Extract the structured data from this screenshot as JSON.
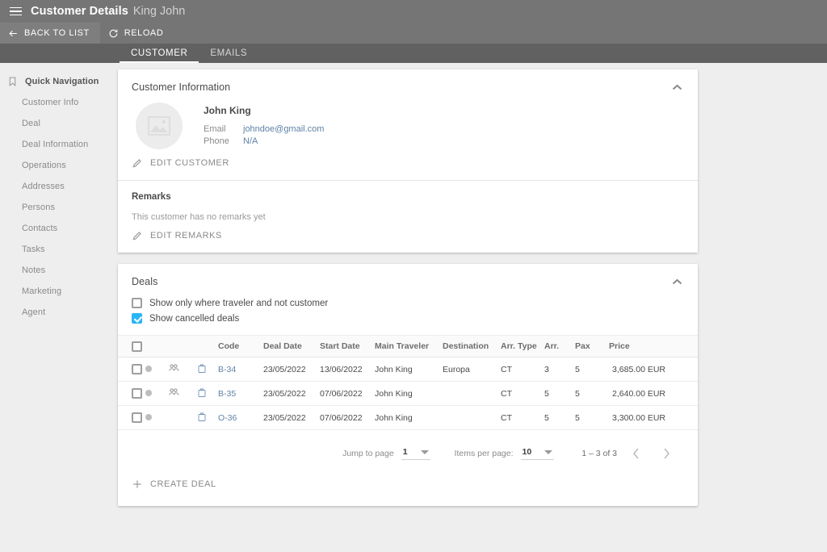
{
  "appbar": {
    "menu_icon": "hamburger-icon",
    "title": "Customer Details",
    "subtitle": "King John"
  },
  "actionbar": {
    "back": {
      "label": "BACK TO LIST",
      "icon": "arrow-left-icon"
    },
    "reload": {
      "label": "RELOAD",
      "icon": "reload-icon"
    }
  },
  "tabs": [
    {
      "label": "CUSTOMER",
      "active": true
    },
    {
      "label": "EMAILS",
      "active": false
    }
  ],
  "sidebar": {
    "header": {
      "label": "Quick Navigation",
      "icon": "bookmark-icon"
    },
    "items": [
      {
        "label": "Customer Info"
      },
      {
        "label": "Deal"
      },
      {
        "label": "Deal Information"
      },
      {
        "label": "Operations"
      },
      {
        "label": "Addresses"
      },
      {
        "label": "Persons"
      },
      {
        "label": "Contacts"
      },
      {
        "label": "Tasks"
      },
      {
        "label": "Notes"
      },
      {
        "label": "Marketing"
      },
      {
        "label": "Agent"
      }
    ]
  },
  "customer_card": {
    "title": "Customer Information",
    "collapse_icon": "chevron-up-icon",
    "avatar_icon": "image-placeholder-icon",
    "name": "John King",
    "fields": [
      {
        "label": "Email",
        "value": "johndoe@gmail.com"
      },
      {
        "label": "Phone",
        "value": "N/A"
      }
    ],
    "edit_button": {
      "label": "EDIT CUSTOMER",
      "icon": "pencil-icon"
    },
    "remarks": {
      "title": "Remarks",
      "text": "This customer has no remarks yet",
      "edit_button": {
        "label": "EDIT REMARKS",
        "icon": "pencil-icon"
      }
    }
  },
  "deals_card": {
    "title": "Deals",
    "collapse_icon": "chevron-up-icon",
    "filters": [
      {
        "label": "Show only where traveler and not customer",
        "checked": false
      },
      {
        "label": "Show cancelled deals",
        "checked": true
      }
    ],
    "columns": [
      "",
      "",
      "",
      "",
      "Code",
      "Deal Date",
      "Start Date",
      "Main Traveler",
      "Destination",
      "Arr. Type",
      "Arr.",
      "Pax",
      "Price"
    ],
    "rows": [
      {
        "selected": false,
        "status_dot": true,
        "people_icon": true,
        "case_icon": true,
        "code": "B-34",
        "deal_date": "23/05/2022",
        "start_date": "13/06/2022",
        "main_traveler": "John King",
        "destination": "Europa",
        "arr_type": "CT",
        "arr": "3",
        "pax": "5",
        "price": "3,685.00 EUR"
      },
      {
        "selected": false,
        "status_dot": true,
        "people_icon": true,
        "case_icon": true,
        "code": "B-35",
        "deal_date": "23/05/2022",
        "start_date": "07/06/2022",
        "main_traveler": "John King",
        "destination": "",
        "arr_type": "CT",
        "arr": "5",
        "pax": "5",
        "price": "2,640.00 EUR"
      },
      {
        "selected": false,
        "status_dot": true,
        "people_icon": false,
        "case_icon": true,
        "code": "O-36",
        "deal_date": "23/05/2022",
        "start_date": "07/06/2022",
        "main_traveler": "John King",
        "destination": "",
        "arr_type": "CT",
        "arr": "5",
        "pax": "5",
        "price": "3,300.00 EUR"
      }
    ],
    "paginator": {
      "jump_label": "Jump to page",
      "jump_value": "1",
      "items_label": "Items per page:",
      "items_value": "10",
      "range": "1 – 3 of 3",
      "prev_icon": "chevron-left-icon",
      "next_icon": "chevron-right-icon"
    },
    "create_button": {
      "label": "CREATE DEAL",
      "icon": "plus-icon"
    }
  },
  "colors": {
    "appbar_bg": "#757575",
    "tabsbar_bg": "#616161",
    "page_bg": "#eeeeee",
    "link": "#5f82a6",
    "checkbox_checked": "#29b6f6"
  }
}
